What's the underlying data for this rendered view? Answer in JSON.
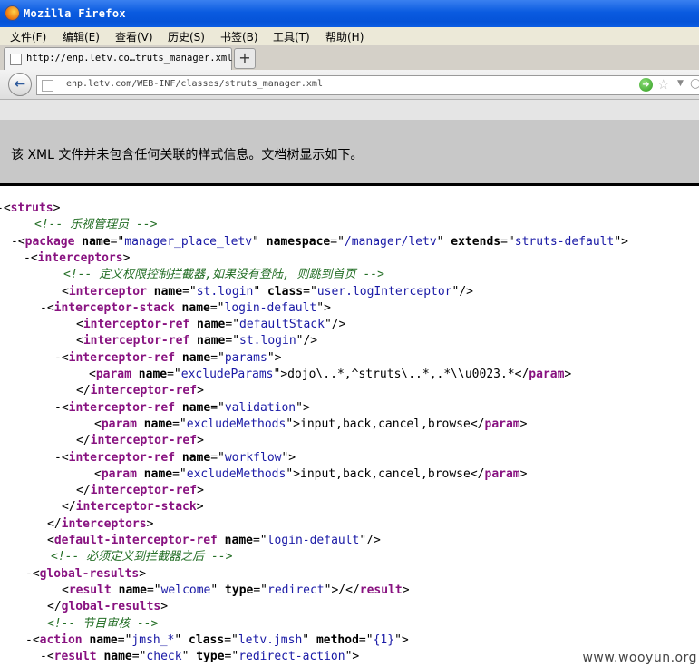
{
  "window": {
    "title": "Mozilla Firefox"
  },
  "menu": [
    "文件(F)",
    "编辑(E)",
    "查看(V)",
    "历史(S)",
    "书签(B)",
    "工具(T)",
    "帮助(H)"
  ],
  "tab": {
    "label": "http://enp.letv.co…truts_manager.xml",
    "new_tab": "+"
  },
  "nav": {
    "url": "enp.letv.com/WEB-INF/classes/struts_manager.xml"
  },
  "info_banner": "该 XML 文件并未包含任何关联的样式信息。文档树显示如下。",
  "xml_lines": [
    [
      [
        "m",
        "-"
      ],
      [
        "t",
        "<"
      ],
      [
        "g",
        "struts"
      ],
      [
        "t",
        ">"
      ]
    ],
    [
      [
        "c",
        "<!-- 乐视管理员 -->"
      ]
    ],
    [
      [
        "m",
        "-"
      ],
      [
        "t",
        "<"
      ],
      [
        "g",
        "package"
      ],
      [
        "a",
        " name"
      ],
      [
        "t",
        "=\""
      ],
      [
        "v",
        "manager_place_letv"
      ],
      [
        "t",
        "\""
      ],
      [
        "a",
        " namespace"
      ],
      [
        "t",
        "=\""
      ],
      [
        "v",
        "/manager/letv"
      ],
      [
        "t",
        "\""
      ],
      [
        "a",
        " extends"
      ],
      [
        "t",
        "=\""
      ],
      [
        "v",
        "struts-default"
      ],
      [
        "t",
        "\">"
      ]
    ],
    [
      [
        "m",
        "-"
      ],
      [
        "t",
        "<"
      ],
      [
        "g",
        "interceptors"
      ],
      [
        "t",
        ">"
      ]
    ],
    [
      [
        "c",
        "<!-- 定义权限控制拦截器,如果没有登陆, 则跳到首页 -->"
      ]
    ],
    [
      [
        "t",
        "<"
      ],
      [
        "g",
        "interceptor"
      ],
      [
        "a",
        " name"
      ],
      [
        "t",
        "=\""
      ],
      [
        "v",
        "st.login"
      ],
      [
        "t",
        "\""
      ],
      [
        "a",
        " class"
      ],
      [
        "t",
        "=\""
      ],
      [
        "v",
        "user.logInterceptor"
      ],
      [
        "t",
        "\"/>"
      ]
    ],
    [
      [
        "m",
        "-"
      ],
      [
        "t",
        "<"
      ],
      [
        "g",
        "interceptor-stack"
      ],
      [
        "a",
        " name"
      ],
      [
        "t",
        "=\""
      ],
      [
        "v",
        "login-default"
      ],
      [
        "t",
        "\">"
      ]
    ],
    [
      [
        "t",
        "<"
      ],
      [
        "g",
        "interceptor-ref"
      ],
      [
        "a",
        " name"
      ],
      [
        "t",
        "=\""
      ],
      [
        "v",
        "defaultStack"
      ],
      [
        "t",
        "\"/>"
      ]
    ],
    [
      [
        "t",
        "<"
      ],
      [
        "g",
        "interceptor-ref"
      ],
      [
        "a",
        " name"
      ],
      [
        "t",
        "=\""
      ],
      [
        "v",
        "st.login"
      ],
      [
        "t",
        "\"/>"
      ]
    ],
    [
      [
        "m",
        "-"
      ],
      [
        "t",
        "<"
      ],
      [
        "g",
        "interceptor-ref"
      ],
      [
        "a",
        " name"
      ],
      [
        "t",
        "=\""
      ],
      [
        "v",
        "params"
      ],
      [
        "t",
        "\">"
      ]
    ],
    [
      [
        "t",
        "<"
      ],
      [
        "g",
        "param"
      ],
      [
        "a",
        " name"
      ],
      [
        "t",
        "=\""
      ],
      [
        "v",
        "excludeParams"
      ],
      [
        "t",
        "\">"
      ],
      [
        "x",
        "dojo\\..*,^struts\\..*,.*\\\\u0023.*"
      ],
      [
        "t",
        "</"
      ],
      [
        "g",
        "param"
      ],
      [
        "t",
        ">"
      ]
    ],
    [
      [
        "t",
        "</"
      ],
      [
        "g",
        "interceptor-ref"
      ],
      [
        "t",
        ">"
      ]
    ],
    [
      [
        "m",
        "-"
      ],
      [
        "t",
        "<"
      ],
      [
        "g",
        "interceptor-ref"
      ],
      [
        "a",
        " name"
      ],
      [
        "t",
        "=\""
      ],
      [
        "v",
        "validation"
      ],
      [
        "t",
        "\">"
      ]
    ],
    [
      [
        "t",
        "<"
      ],
      [
        "g",
        "param"
      ],
      [
        "a",
        " name"
      ],
      [
        "t",
        "=\""
      ],
      [
        "v",
        "excludeMethods"
      ],
      [
        "t",
        "\">"
      ],
      [
        "x",
        "input,back,cancel,browse"
      ],
      [
        "t",
        "</"
      ],
      [
        "g",
        "param"
      ],
      [
        "t",
        ">"
      ]
    ],
    [
      [
        "t",
        "</"
      ],
      [
        "g",
        "interceptor-ref"
      ],
      [
        "t",
        ">"
      ]
    ],
    [
      [
        "m",
        "-"
      ],
      [
        "t",
        "<"
      ],
      [
        "g",
        "interceptor-ref"
      ],
      [
        "a",
        " name"
      ],
      [
        "t",
        "=\""
      ],
      [
        "v",
        "workflow"
      ],
      [
        "t",
        "\">"
      ]
    ],
    [
      [
        "t",
        "<"
      ],
      [
        "g",
        "param"
      ],
      [
        "a",
        " name"
      ],
      [
        "t",
        "=\""
      ],
      [
        "v",
        "excludeMethods"
      ],
      [
        "t",
        "\">"
      ],
      [
        "x",
        "input,back,cancel,browse"
      ],
      [
        "t",
        "</"
      ],
      [
        "g",
        "param"
      ],
      [
        "t",
        ">"
      ]
    ],
    [
      [
        "t",
        "</"
      ],
      [
        "g",
        "interceptor-ref"
      ],
      [
        "t",
        ">"
      ]
    ],
    [
      [
        "t",
        "</"
      ],
      [
        "g",
        "interceptor-stack"
      ],
      [
        "t",
        ">"
      ]
    ],
    [
      [
        "t",
        "</"
      ],
      [
        "g",
        "interceptors"
      ],
      [
        "t",
        ">"
      ]
    ],
    [
      [
        "t",
        "<"
      ],
      [
        "g",
        "default-interceptor-ref"
      ],
      [
        "a",
        " name"
      ],
      [
        "t",
        "=\""
      ],
      [
        "v",
        "login-default"
      ],
      [
        "t",
        "\"/>"
      ]
    ],
    [
      [
        "c",
        "<!-- 必须定义到拦截器之后 -->"
      ]
    ],
    [
      [
        "m",
        "-"
      ],
      [
        "t",
        "<"
      ],
      [
        "g",
        "global-results"
      ],
      [
        "t",
        ">"
      ]
    ],
    [
      [
        "t",
        "<"
      ],
      [
        "g",
        "result"
      ],
      [
        "a",
        " name"
      ],
      [
        "t",
        "=\""
      ],
      [
        "v",
        "welcome"
      ],
      [
        "t",
        "\""
      ],
      [
        "a",
        " type"
      ],
      [
        "t",
        "=\""
      ],
      [
        "v",
        "redirect"
      ],
      [
        "t",
        "\">"
      ],
      [
        "x",
        "/"
      ],
      [
        "t",
        "</"
      ],
      [
        "g",
        "result"
      ],
      [
        "t",
        ">"
      ]
    ],
    [
      [
        "t",
        "</"
      ],
      [
        "g",
        "global-results"
      ],
      [
        "t",
        ">"
      ]
    ],
    [
      [
        "c",
        "<!-- 节目审核 -->"
      ]
    ],
    [
      [
        "m",
        "-"
      ],
      [
        "t",
        "<"
      ],
      [
        "g",
        "action"
      ],
      [
        "a",
        " name"
      ],
      [
        "t",
        "=\""
      ],
      [
        "v",
        "jmsh_*"
      ],
      [
        "t",
        "\""
      ],
      [
        "a",
        " class"
      ],
      [
        "t",
        "=\""
      ],
      [
        "v",
        "letv.jmsh"
      ],
      [
        "t",
        "\""
      ],
      [
        "a",
        " method"
      ],
      [
        "t",
        "=\""
      ],
      [
        "v",
        "{1}"
      ],
      [
        "t",
        "\">"
      ]
    ],
    [
      [
        "m",
        "-"
      ],
      [
        "t",
        "<"
      ],
      [
        "g",
        "result"
      ],
      [
        "a",
        " name"
      ],
      [
        "t",
        "=\""
      ],
      [
        "v",
        "check"
      ],
      [
        "t",
        "\""
      ],
      [
        "a",
        " type"
      ],
      [
        "t",
        "=\""
      ],
      [
        "v",
        "redirect-action"
      ],
      [
        "t",
        "\">"
      ]
    ]
  ],
  "watermark": "www.wooyun.org"
}
